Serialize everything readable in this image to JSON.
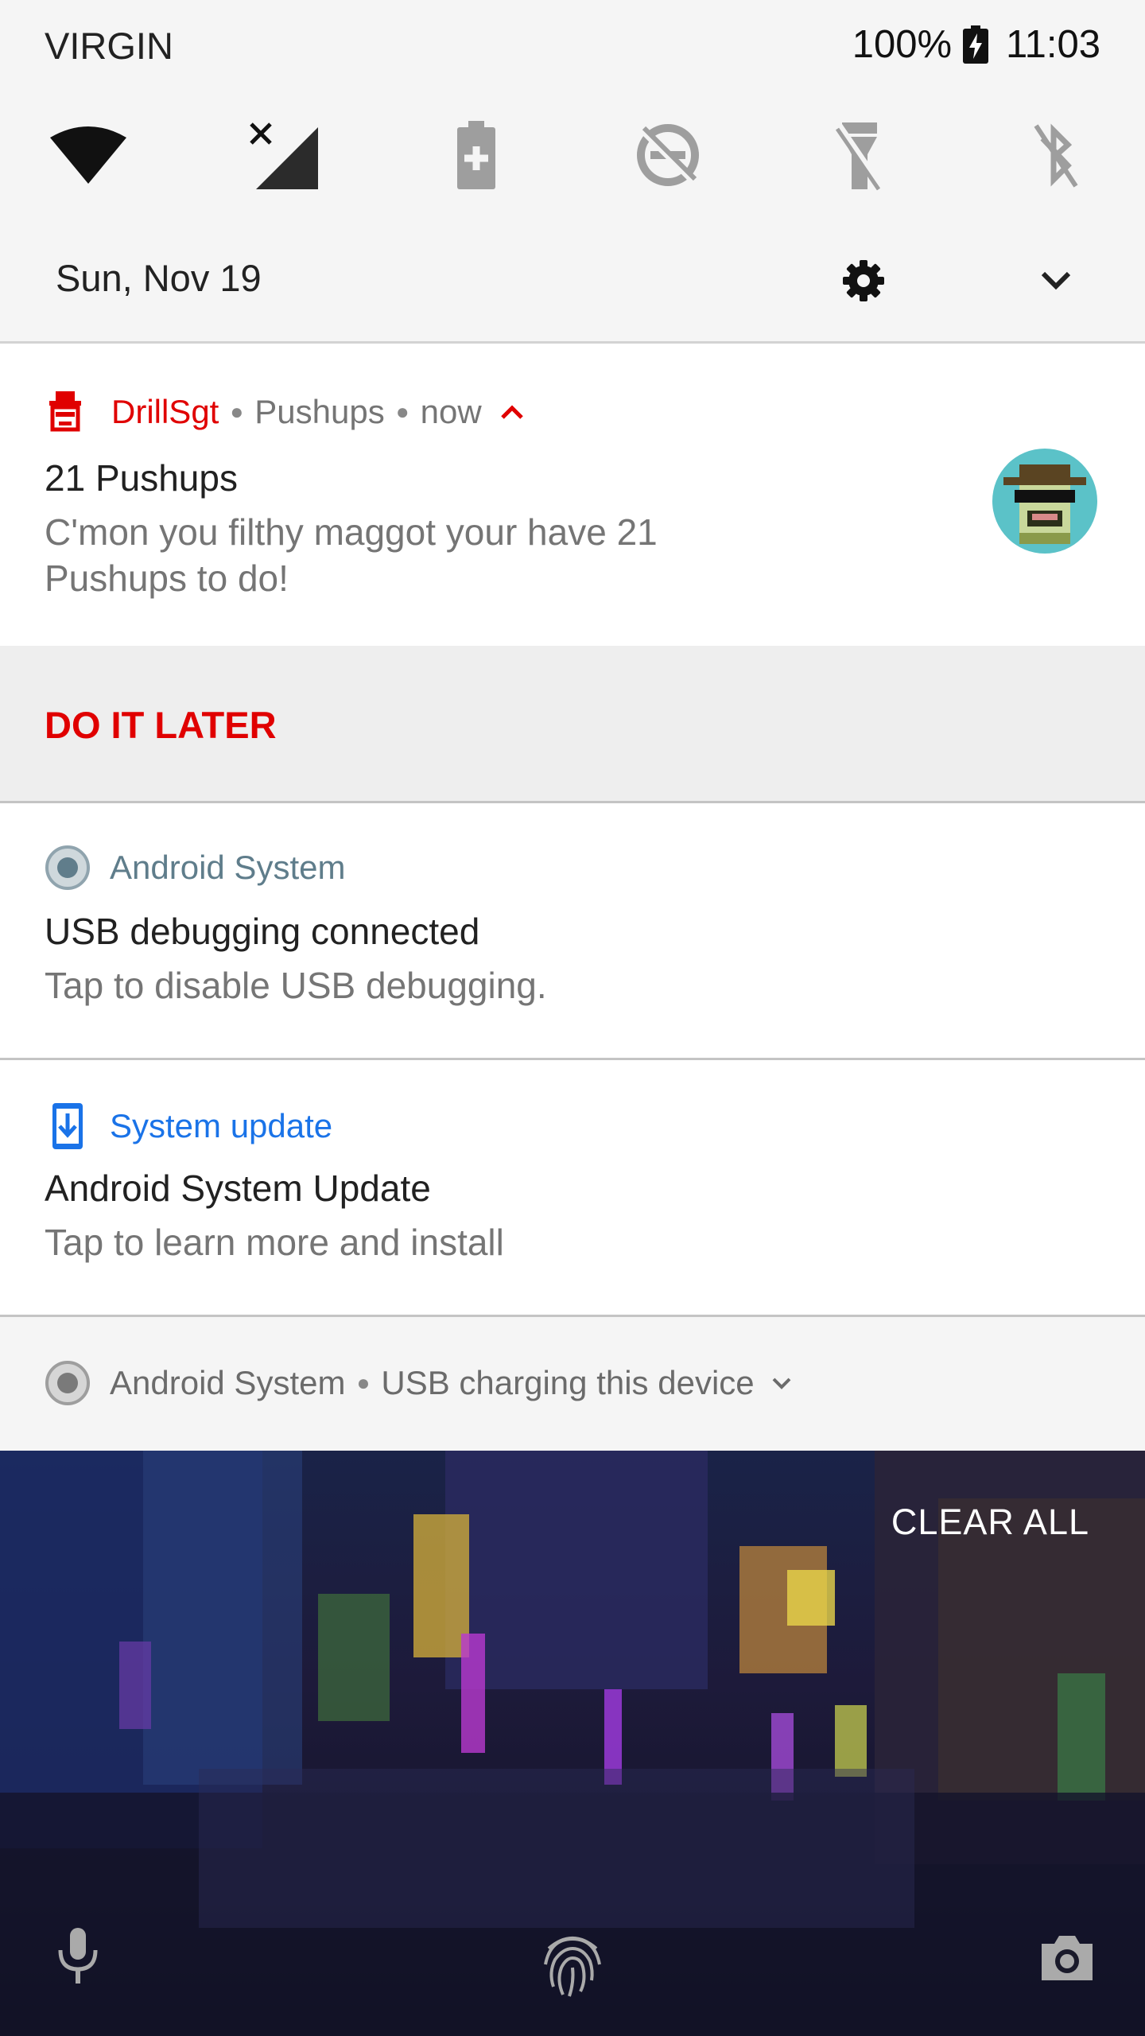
{
  "status_bar": {
    "carrier": "VIRGIN",
    "battery_percent": "100%",
    "time": "11:03"
  },
  "quick_settings": {
    "tiles": [
      {
        "icon": "wifi-icon"
      },
      {
        "icon": "mobile-data-off-icon"
      },
      {
        "icon": "battery-saver-icon"
      },
      {
        "icon": "do-not-disturb-off-icon"
      },
      {
        "icon": "flashlight-off-icon"
      },
      {
        "icon": "bluetooth-off-icon"
      }
    ],
    "date": "Sun, Nov 19"
  },
  "notifications": {
    "drillsgt": {
      "app_name": "DrillSgt",
      "subtext": "Pushups",
      "time": "now",
      "title": "21 Pushups",
      "text": "C'mon you filthy maggot your have 21 Pushups to do!",
      "action": "DO IT LATER",
      "accent": "#e00000"
    },
    "usb_debug": {
      "app_name": "Android System",
      "title": "USB debugging connected",
      "text": "Tap to disable USB debugging."
    },
    "system_update": {
      "app_name": "System update",
      "title": "Android System Update",
      "text": "Tap to learn more and install",
      "accent": "#1a73e8"
    },
    "usb_charging": {
      "app_name": "Android System",
      "text": "USB charging this device"
    }
  },
  "lockscreen": {
    "clear_all": "CLEAR ALL",
    "icons": [
      "microphone-icon",
      "fingerprint-icon",
      "camera-icon"
    ]
  }
}
